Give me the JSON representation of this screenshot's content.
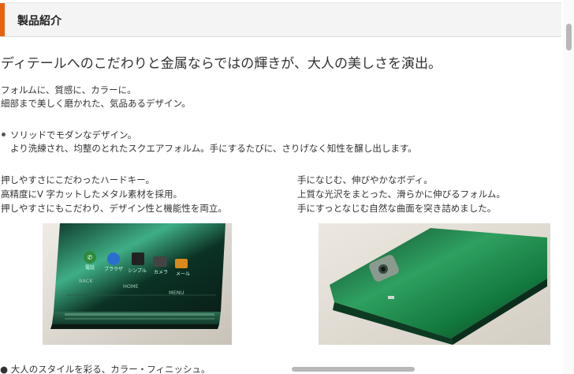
{
  "section": {
    "title": "製品紹介",
    "accent_color": "#e8620e"
  },
  "headline": "ディテールへのこだわりと金属ならではの輝きが、大人の美しさを演出。",
  "intro": {
    "line1": "フォルムに、質感に、カラーに。",
    "line2": "細部まで美しく磨かれた、気品あるデザイン。"
  },
  "feature": {
    "title": "ソリッドでモダンなデザイン。",
    "desc": "より洗練され、均整のとれたスクエアフォルム。手にするたびに、さりげなく知性を醸し出します。"
  },
  "left_col": {
    "line1": "押しやすさにこだわったハードキー。",
    "line2": "高精度にV 字カットしたメタル素材を採用。",
    "line3": "押しやすさにもこだわり、デザイン性と機能性を両立。"
  },
  "right_col": {
    "line1": "手になじむ、伸びやかなボディ。",
    "line2": "上質な光沢をまとった、滑らかに伸びるフォルム。",
    "line3": "手にすっとなじむ自然な曲面を突き詰めました。"
  },
  "phone_ui": {
    "apps": [
      "電話",
      "ブラウザ",
      "シンプル",
      "カメラ",
      "メール"
    ],
    "keys": [
      "BACK",
      "HOME",
      "MENU"
    ]
  },
  "cut_text": "● 大人のスタイルを彩る、カラー・フィニッシュ。"
}
